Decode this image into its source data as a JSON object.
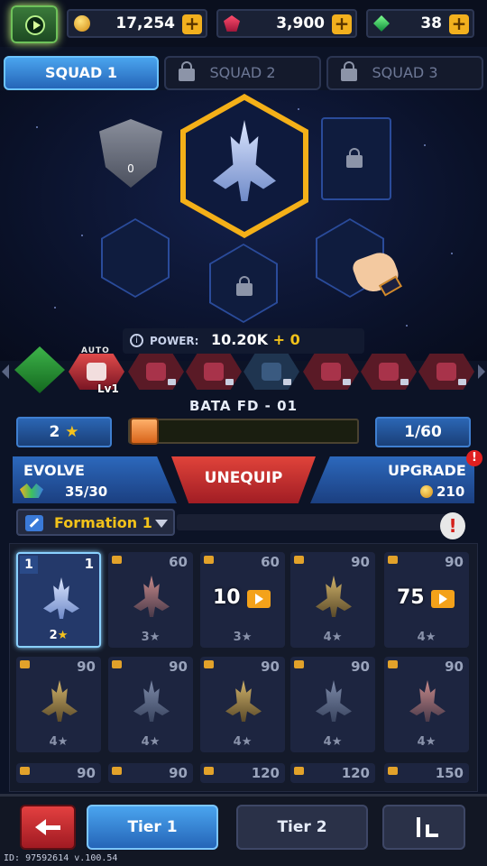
{
  "resources": {
    "gold": "17,254",
    "ruby": "3,900",
    "emerald": "38"
  },
  "squad_tabs": [
    {
      "label": "SQUAD 1",
      "locked": false
    },
    {
      "label": "SQUAD 2",
      "locked": true
    },
    {
      "label": "SQUAD 3",
      "locked": true
    }
  ],
  "squad": {
    "shield_count": "0"
  },
  "power": {
    "label": "POWER:",
    "value": "10.20K",
    "bonus": "+ 0"
  },
  "skills": {
    "auto_label": "AUTO",
    "level_label": "Lv1"
  },
  "ship": {
    "name": "BATA FD - 01",
    "stars": "2",
    "progress": "1/60",
    "progress_fraction": 0.017
  },
  "actions": {
    "evolve_label": "EVOLVE",
    "evolve_value": "35/30",
    "unequip_label": "UNEQUIP",
    "upgrade_label": "UPGRADE",
    "upgrade_value": "210",
    "notif": "!"
  },
  "formation": {
    "label": "Formation 1",
    "alert": "!"
  },
  "cards": [
    {
      "slot": "1",
      "num": "1",
      "stars": "2",
      "selected": true
    },
    {
      "num": "60",
      "stars": "3"
    },
    {
      "num": "60",
      "stars": "3",
      "timer": "10"
    },
    {
      "num": "90",
      "stars": "4"
    },
    {
      "num": "90",
      "stars": "4",
      "timer": "75"
    },
    {
      "num": "90",
      "stars": "4"
    },
    {
      "num": "90",
      "stars": "4"
    },
    {
      "num": "90",
      "stars": "4"
    },
    {
      "num": "90",
      "stars": "4"
    },
    {
      "num": "90",
      "stars": "4"
    },
    {
      "num": "90"
    },
    {
      "num": "90"
    },
    {
      "num": "120"
    },
    {
      "num": "120"
    },
    {
      "num": "150"
    }
  ],
  "bottom_nav": {
    "tier1": "Tier 1",
    "tier2": "Tier 2"
  },
  "version": "ID: 97592614 v.100.54",
  "colors": {
    "accent_blue": "#2f7fd6",
    "gold": "#f2c21a",
    "red": "#d43030"
  }
}
